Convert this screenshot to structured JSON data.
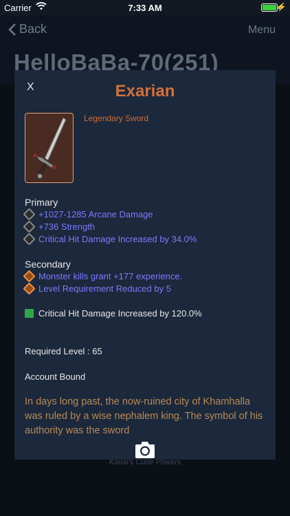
{
  "status": {
    "carrier": "Carrier",
    "time": "7:33 AM"
  },
  "nav": {
    "back_label": "Back",
    "menu_label": "Menu",
    "title": "HelloBaBa-70(251)"
  },
  "background": {
    "cube_label": "Kanai's Cube Powers"
  },
  "item": {
    "close_label": "X",
    "name": "Exarian",
    "type": "Legendary Sword",
    "primary_label": "Primary",
    "primary_stats": [
      "+1027-1285 Arcane Damage",
      "+736 Strength",
      "Critical Hit Damage Increased by 34.0%"
    ],
    "secondary_label": "Secondary",
    "secondary_stats": [
      "Monster kills grant +177 experience.",
      "Level Requirement Reduced by 5"
    ],
    "socket_stat": "Critical Hit Damage Increased by 120.0%",
    "required_level": "Required Level : 65",
    "bound": "Account Bound",
    "flavor": "In days long past, the now-ruined city of Khamhalla was ruled by a wise nephalem king. The symbol of his authority was the sword"
  },
  "colors": {
    "title": "#d4703b",
    "magic_stat": "#7b7bff",
    "flavor": "#b98a56"
  }
}
